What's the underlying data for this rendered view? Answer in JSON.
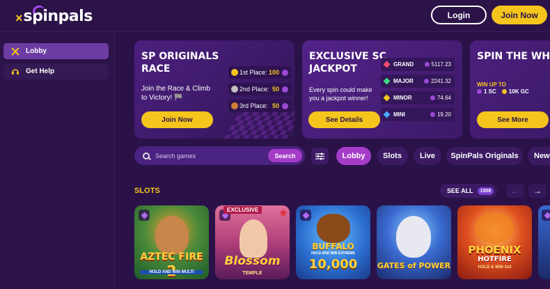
{
  "header": {
    "logo": "spinpals",
    "login_label": "Login",
    "join_label": "Join Now"
  },
  "sidebar": {
    "items": [
      {
        "label": "Lobby",
        "icon": "crossed-swords-icon",
        "active": true
      },
      {
        "label": "Get Help",
        "icon": "headset-icon",
        "active": false
      }
    ]
  },
  "promos": {
    "race": {
      "title_line1": "SP ORIGINALS",
      "title_line2": "RACE",
      "desc_line1": "Join the Race & Climb",
      "desc_line2": "to Victory! 🏁",
      "button": "Join Now",
      "places": [
        {
          "label": "1st Place:",
          "value": "100",
          "medal_color": "#f5c51d"
        },
        {
          "label": "2nd Place:",
          "value": "50",
          "medal_color": "#c0c0c0"
        },
        {
          "label": "3rd Place:",
          "value": "50",
          "medal_color": "#cd7f32"
        }
      ]
    },
    "jackpot": {
      "title_line1": "EXCLUSIVE SC",
      "title_line2": "JACKPOT",
      "desc_line1": "Every spin could make",
      "desc_line2": "you a jackpot winner!",
      "button": "See Details",
      "tiers": [
        {
          "name": "GRAND",
          "amount": "5117.23",
          "gem_color": "#ff4d6d"
        },
        {
          "name": "MAJOR",
          "amount": "2241.32",
          "gem_color": "#3ddc84"
        },
        {
          "name": "MINOR",
          "amount": "74.64",
          "gem_color": "#f5c51d"
        },
        {
          "name": "MINI",
          "amount": "19.20",
          "gem_color": "#4aa8ff"
        }
      ]
    },
    "spin": {
      "title": "SPIN THE WHI",
      "win_up_to": "WIN UP TO",
      "sc": "1 SC",
      "gc": "10K GC",
      "button": "See More"
    }
  },
  "search": {
    "placeholder": "Search games",
    "button": "Search"
  },
  "tabs": [
    {
      "label": "Lobby",
      "active": true
    },
    {
      "label": "Slots",
      "active": false
    },
    {
      "label": "Live",
      "active": false
    },
    {
      "label": "SpinPals Originals",
      "active": false
    },
    {
      "label": "New",
      "active": false
    }
  ],
  "slots": {
    "title": "SLOTS",
    "see_all": "SEE ALL",
    "count": "1508",
    "games": [
      {
        "title_line1": "AZTEC FIRE",
        "title_line2": "2",
        "sub": "HOLD AND WIN MULTI",
        "bg": "#2f7a3a"
      },
      {
        "badge": "EXCLUSIVE",
        "title_line1": "Blossom",
        "title_line2": "TEMPLE",
        "bg": "#b0407a"
      },
      {
        "title_line1": "BUFFALO",
        "title_line2": "10,000",
        "sub": "HOLD AND WIN EXTREME",
        "bg": "#2c6fd0"
      },
      {
        "title_line1": "GATES of POWER",
        "bg": "#1f3e9a"
      },
      {
        "title_line1": "PHOENIX",
        "title_line2": "HOTFIRE",
        "sub": "HOLD & WIN 3x3",
        "bg": "#c0301a"
      }
    ]
  }
}
